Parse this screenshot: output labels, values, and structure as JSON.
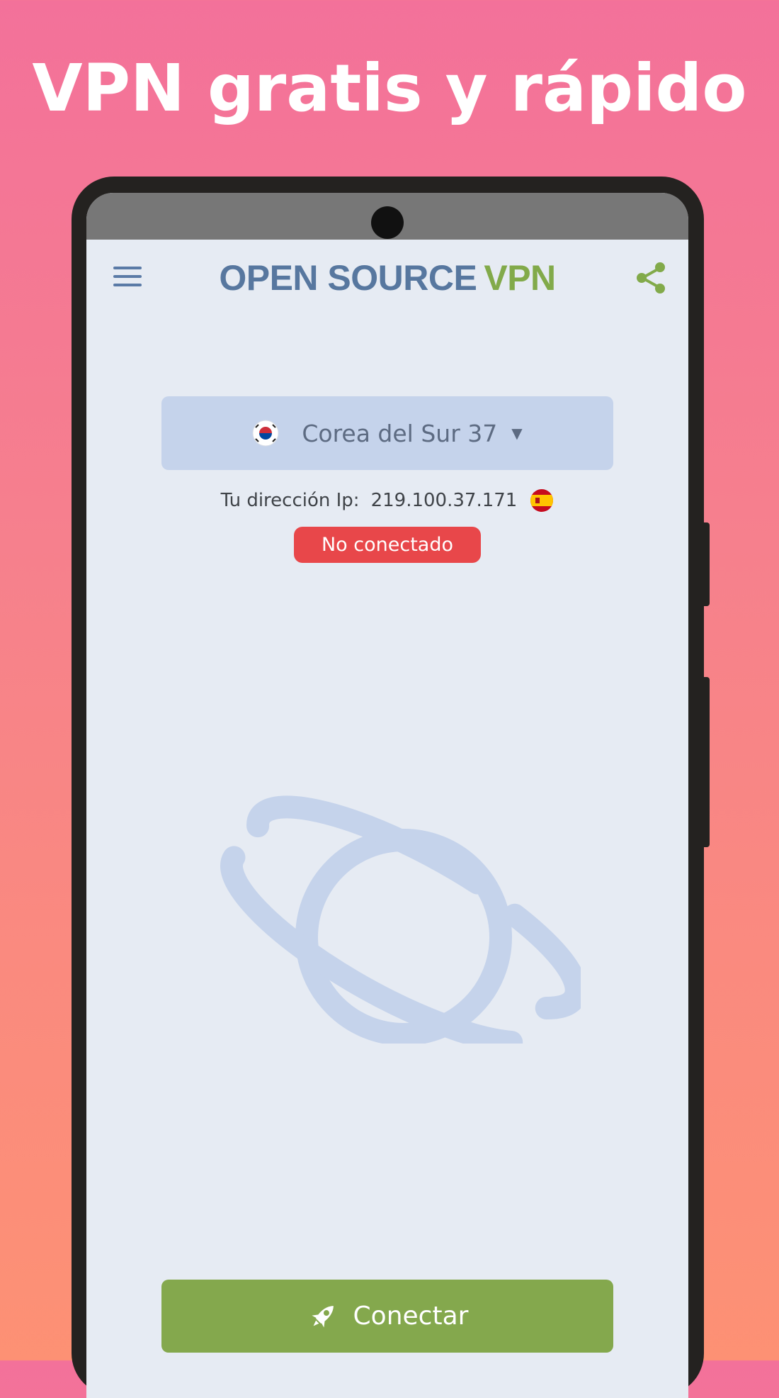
{
  "promo": {
    "headline": "VPN gratis y rápido"
  },
  "app": {
    "logo_part1": "OPEN SOURCE",
    "logo_part2": "VPN",
    "menu_icon": "hamburger-menu-icon",
    "share_icon": "share-icon"
  },
  "server": {
    "selected": "Corea del Sur 37",
    "flag": "south-korea-flag-icon",
    "dropdown_icon": "dropdown-caret-icon"
  },
  "ip": {
    "label": "Tu dirección Ip:",
    "value": "219.100.37.171",
    "flag": "spain-flag-icon"
  },
  "status": {
    "text": "No conectado",
    "color": "#e8474a"
  },
  "connect_button": {
    "label": "Conectar",
    "icon": "rocket-icon",
    "color": "#84a84d"
  },
  "colors": {
    "background_top": "#f3719a",
    "background_bottom": "#fd9174",
    "screen": "#e6ebf3",
    "brand_blue": "#57779f",
    "brand_green": "#82aa4a",
    "planet": "#c5d3eb"
  }
}
